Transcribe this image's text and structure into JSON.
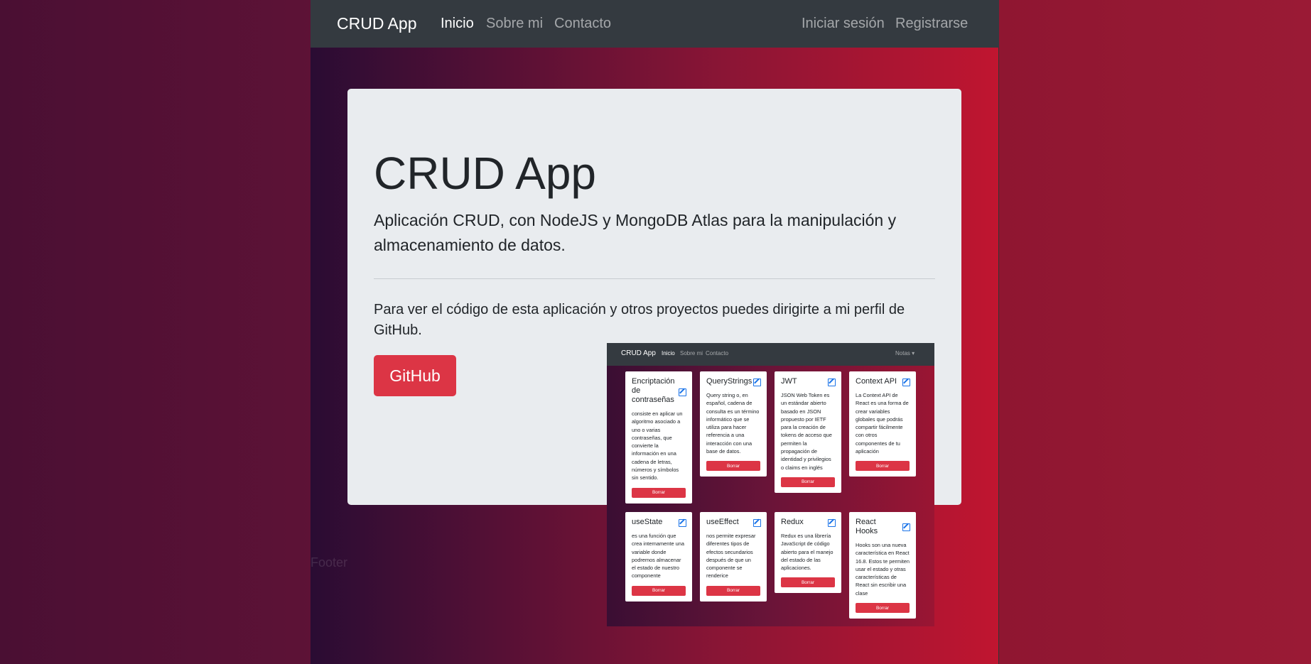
{
  "navbar": {
    "brand": "CRUD App",
    "links": [
      "Inicio",
      "Sobre mi",
      "Contacto"
    ],
    "auth": [
      "Iniciar sesión",
      "Registrarse"
    ]
  },
  "jumbotron": {
    "title": "CRUD App",
    "lead": "Aplicación CRUD, con NodeJS y MongoDB Atlas para la manipulación y almacenamiento de datos.",
    "text": "Para ver el código de esta aplicación y otros proyectos puedes dirigirte a mi perfil de GitHub.",
    "button": "GitHub"
  },
  "footer": "Footer",
  "preview": {
    "brand": "CRUD App",
    "links": [
      "Inicio",
      "Sobre mi",
      "Contacto"
    ],
    "menu": "Notas ▾",
    "delete_label": "Borrar",
    "cards": [
      {
        "title": "Encriptación de contraseñas",
        "text": "consiste en aplicar un algoritmo asociado a uno o varias contraseñas, que convierte la información en una cadena de letras, números y símbolos sin sentido."
      },
      {
        "title": "QueryStrings",
        "text": "Query string o, en español, cadena de consulta es un término informático que se utiliza para hacer referencia a una interacción con una base de datos."
      },
      {
        "title": "JWT",
        "text": "JSON Web Token es un estándar abierto basado en JSON propuesto por IETF para la creación de tokens de acceso que permiten la propagación de identidad y privilegios o claims en inglés"
      },
      {
        "title": "Context API",
        "text": "La Context API de React es una forma de crear variables globales que podrás compartir fácilmente con otros componentes de tu aplicación"
      },
      {
        "title": "useState",
        "text": "es una función que crea internamente una variable donde podremos almacenar el estado de nuestro componente"
      },
      {
        "title": "useEffect",
        "text": "nos permite expresar diferentes tipos de efectos secundarios después de que un componente se renderice"
      },
      {
        "title": "Redux",
        "text": "Redux es una librería JavaScript de código abierto para el manejo del estado de las aplicaciones."
      },
      {
        "title": "React Hooks",
        "text": "Hooks son una nueva característica en React 16.8. Estos te permiten usar el estado y otras características de React sin escribir una clase"
      }
    ]
  }
}
